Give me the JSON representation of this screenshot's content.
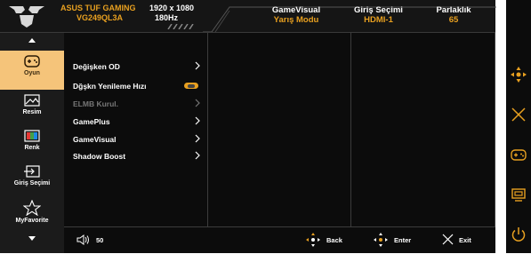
{
  "header": {
    "model_line1": "ASUS TUF GAMING",
    "model_line2": "VG249QL3A",
    "resolution": "1920 x 1080",
    "refresh": "180Hz",
    "gamevisual_title": "GameVisual",
    "gamevisual_value": "Yarış Modu",
    "input_title": "Giriş Seçimi",
    "input_value": "HDMI-1",
    "brightness_title": "Parlaklık",
    "brightness_value": "65"
  },
  "sidebar": {
    "items": [
      {
        "label": "Oyun",
        "icon": "gamepad-icon",
        "active": true
      },
      {
        "label": "Resim",
        "icon": "image-icon"
      },
      {
        "label": "Renk",
        "icon": "color-bars-icon"
      },
      {
        "label": "Giriş Seçimi",
        "icon": "input-icon"
      },
      {
        "label": "MyFavorite",
        "icon": "star-icon"
      }
    ]
  },
  "menu": {
    "items": [
      {
        "label": "Değişken OD",
        "control": "chevron"
      },
      {
        "label": "Dğşkn Yenileme Hızı",
        "control": "toggle"
      },
      {
        "label": "ELMB Kurul.",
        "control": "chevron",
        "disabled": true
      },
      {
        "label": "GamePlus",
        "control": "chevron"
      },
      {
        "label": "GameVisual",
        "control": "chevron"
      },
      {
        "label": "Shadow Boost",
        "control": "chevron"
      }
    ]
  },
  "footer": {
    "volume_icon": "speaker-icon",
    "volume_value": "50",
    "back_label": "Back",
    "enter_label": "Enter",
    "exit_label": "Exit"
  },
  "right_controls": [
    "joystick-icon",
    "close-icon",
    "gamepad-icon",
    "gameplus-icon",
    "power-icon"
  ],
  "colors": {
    "accent": "#e8a020",
    "active_tab": "#f5c47a",
    "background": "#0c0c0c",
    "sidebar": "#1b1b1b"
  }
}
